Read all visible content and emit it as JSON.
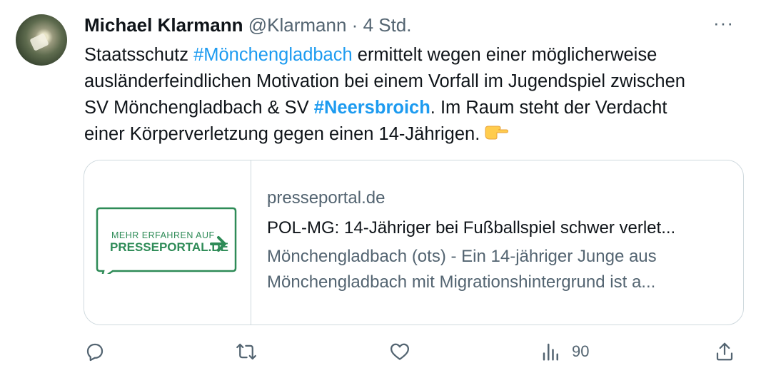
{
  "author": {
    "name": "Michael Klarmann",
    "handle": "@Klarmann",
    "separator": "·",
    "time": "4 Std."
  },
  "more_label": "···",
  "tweet": {
    "line1": {
      "pre": "Staatsschutz ",
      "hashtag": "#Mönchengladbach",
      "post": " ermittelt wegen einer möglicherweise"
    },
    "line2": "ausländerfeindlichen Motivation bei einem Vorfall im Jugendspiel zwischen",
    "line3": {
      "pre": "SV Mönchengladbach & SV ",
      "hashtag": "#Neersbroich",
      "post": ". Im Raum steht der Verdacht"
    },
    "line4": "einer Körperverletzung gegen einen 14-Jährigen."
  },
  "card": {
    "thumbnail": {
      "line1": "MEHR ERFAHREN AUF",
      "line2": "PRESSEPORTAL.DE"
    },
    "domain": "presseportal.de",
    "title": "POL-MG: 14-Jähriger bei Fußballspiel schwer verlet...",
    "desc_line1": "Mönchengladbach (ots) - Ein 14-jähriger Junge aus",
    "desc_line2": "Mönchengladbach mit Migrationshintergrund ist a..."
  },
  "actions": {
    "views_count": "90"
  },
  "colors": {
    "accent": "#1d9bf0",
    "muted": "#536471",
    "border": "#cfd9de",
    "pp_green": "#2e8b57"
  },
  "icons": [
    "reply-icon",
    "retweet-icon",
    "like-icon",
    "views-icon",
    "share-icon",
    "pointing-hand-icon",
    "arrow-right-icon"
  ]
}
